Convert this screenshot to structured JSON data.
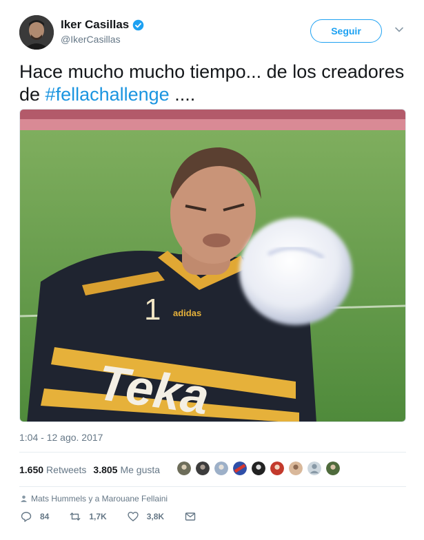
{
  "author": {
    "display_name": "Iker Casillas",
    "handle": "@IkerCasillas",
    "verified": true
  },
  "follow_label": "Seguir",
  "tweet": {
    "text_before": "Hace mucho mucho tiempo... de los creadores de ",
    "hashtag": "#fellachallenge",
    "text_after": " ...."
  },
  "media": {
    "icon": "photo",
    "shirt_number": "1",
    "shirt_brand": "adidas",
    "sponsor": "Teka"
  },
  "timestamp": "1:04 - 12 ago. 2017",
  "stats": {
    "retweets_count": "1.650",
    "retweets_label": "Retweets",
    "likes_count": "3.805",
    "likes_label": "Me gusta"
  },
  "reply_context": "Mats Hummels y a Marouane Fellaini",
  "actions": {
    "reply_count": "84",
    "retweet_count": "1,7K",
    "like_count": "3,8K"
  },
  "colors": {
    "accent": "#1da1f2",
    "hashtag": "#1b95e0",
    "secondary_text": "#657786",
    "pitch_green": "#5f9c48"
  }
}
